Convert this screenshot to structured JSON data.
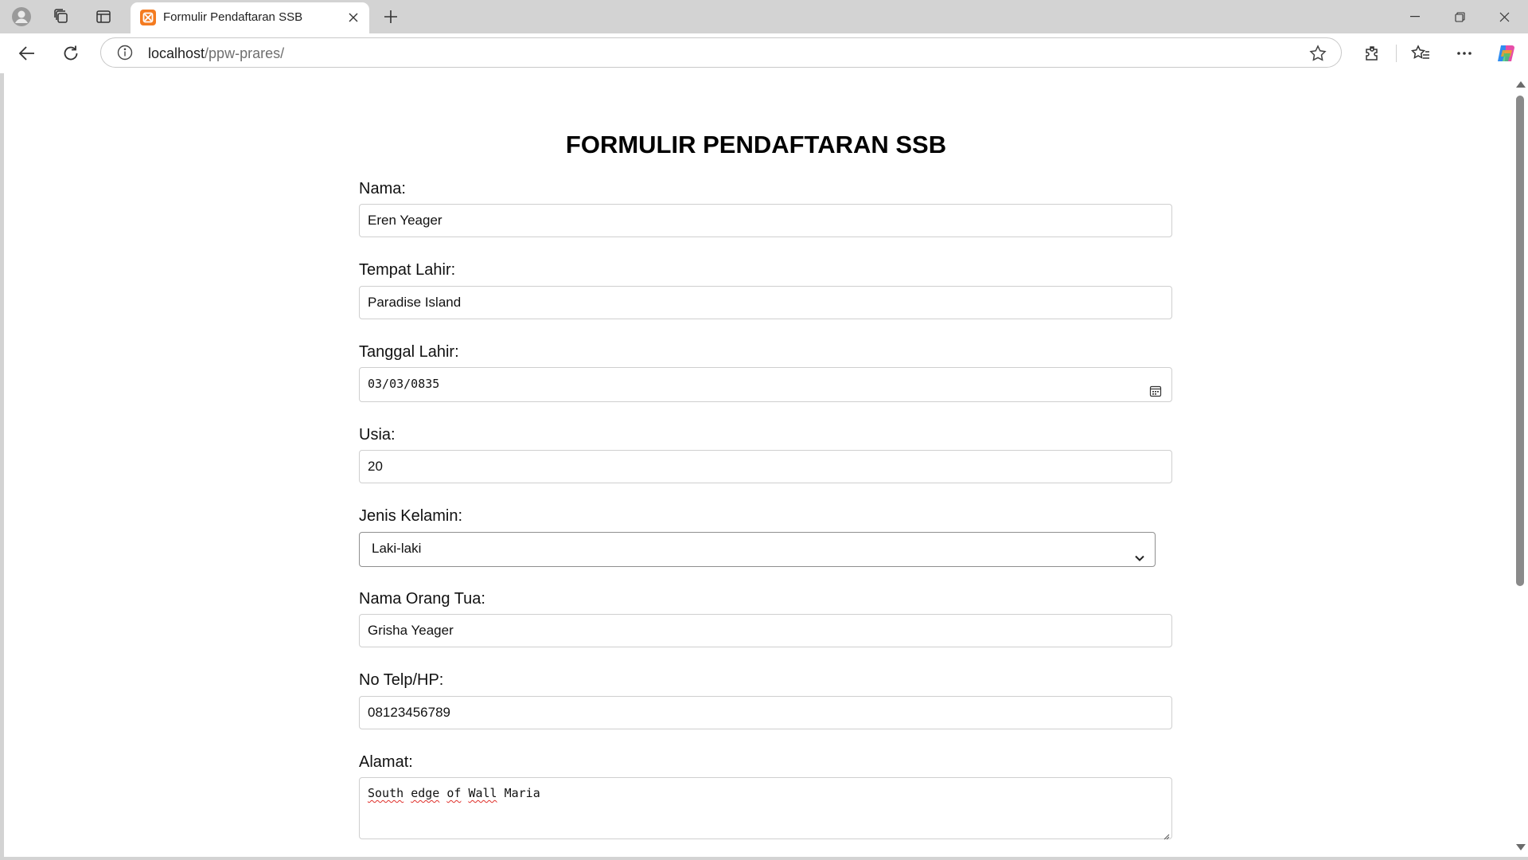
{
  "browser": {
    "tab_title": "Formulir Pendaftaran SSB",
    "url_host": "localhost",
    "url_path": "/ppw-prares/"
  },
  "form": {
    "title": "FORMULIR PENDAFTARAN SSB",
    "nama_label": "Nama:",
    "nama_value": "Eren Yeager",
    "tempat_label": "Tempat Lahir:",
    "tempat_value": "Paradise Island",
    "tanggal_label": "Tanggal Lahir:",
    "tanggal_value": "03/03/0835",
    "usia_label": "Usia:",
    "usia_value": "20",
    "jenis_label": "Jenis Kelamin:",
    "jenis_value": "Laki-laki",
    "ortu_label": "Nama Orang Tua:",
    "ortu_value": "Grisha Yeager",
    "telp_label": "No Telp/HP:",
    "telp_value": "08123456789",
    "alamat_label": "Alamat:",
    "alamat_words": [
      "South",
      "edge",
      "of",
      "Wall",
      "Maria"
    ]
  },
  "colors": {
    "tabstrip": "#d3d3d3",
    "favicon": "#f47b20",
    "spellcheck": "#e0312b"
  },
  "icons": [
    "profile-icon",
    "collections-icon",
    "tab-actions-icon",
    "xampp-favicon",
    "close-icon",
    "plus-icon",
    "minimize-icon",
    "restore-icon",
    "back-icon",
    "refresh-icon",
    "info-icon",
    "star-icon",
    "extensions-icon",
    "favorites-icon",
    "more-icon",
    "copilot-icon",
    "calendar-icon",
    "chevron-down-icon"
  ]
}
